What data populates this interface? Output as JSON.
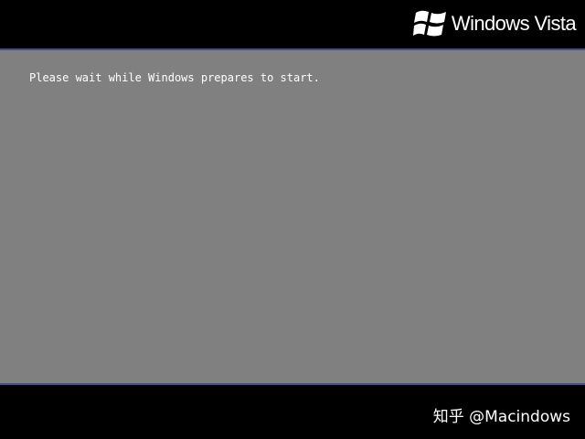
{
  "header": {
    "brand_name": "Windows Vista",
    "logo_icon": "windows-flag-icon"
  },
  "main": {
    "status_message": "Please wait while Windows prepares to start."
  },
  "footer": {
    "watermark": "知乎 @Macindows"
  },
  "colors": {
    "background": "#000000",
    "content_panel": "#808080",
    "divider_lines": "#3f4f93",
    "text": "#ffffff"
  }
}
